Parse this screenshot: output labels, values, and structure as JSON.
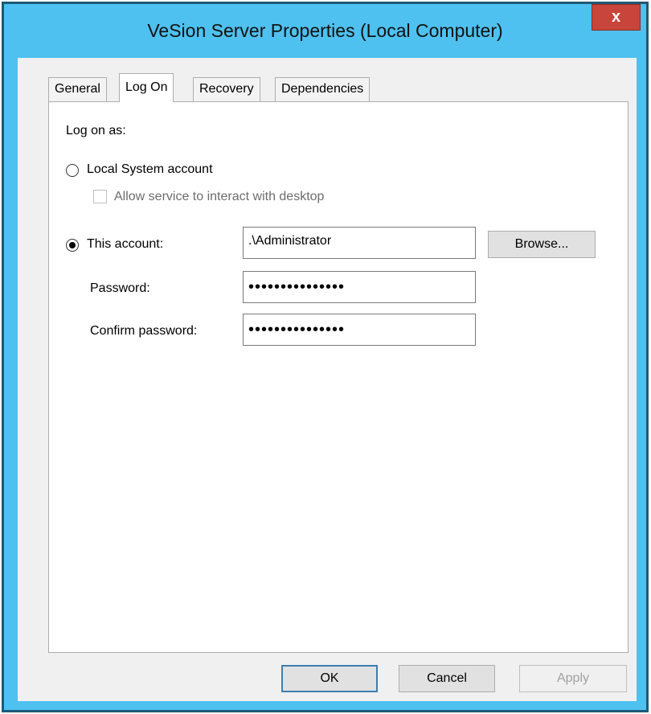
{
  "window": {
    "title": "VeSion Server Properties (Local Computer)",
    "close_glyph": "x"
  },
  "tabs": [
    {
      "label": "General",
      "active": false
    },
    {
      "label": "Log On",
      "active": true
    },
    {
      "label": "Recovery",
      "active": false
    },
    {
      "label": "Dependencies",
      "active": false
    }
  ],
  "logon": {
    "section_label": "Log on as:",
    "local_system": {
      "label": "Local System account",
      "selected": false
    },
    "interact_desktop": {
      "label": "Allow service to interact with desktop",
      "checked": false,
      "enabled": false
    },
    "this_account": {
      "label": "This account:",
      "selected": true,
      "value": ".\\Administrator"
    },
    "browse_label": "Browse...",
    "password": {
      "label": "Password:",
      "value": "•••••••••••••••"
    },
    "confirm_password": {
      "label": "Confirm password:",
      "value": "•••••••••••••••"
    }
  },
  "buttons": {
    "ok": "OK",
    "cancel": "Cancel",
    "apply": "Apply",
    "apply_enabled": false
  },
  "colors": {
    "title_bar": "#4ec1f0",
    "close_button": "#c7453a",
    "default_button_border": "#3c7fb1"
  }
}
